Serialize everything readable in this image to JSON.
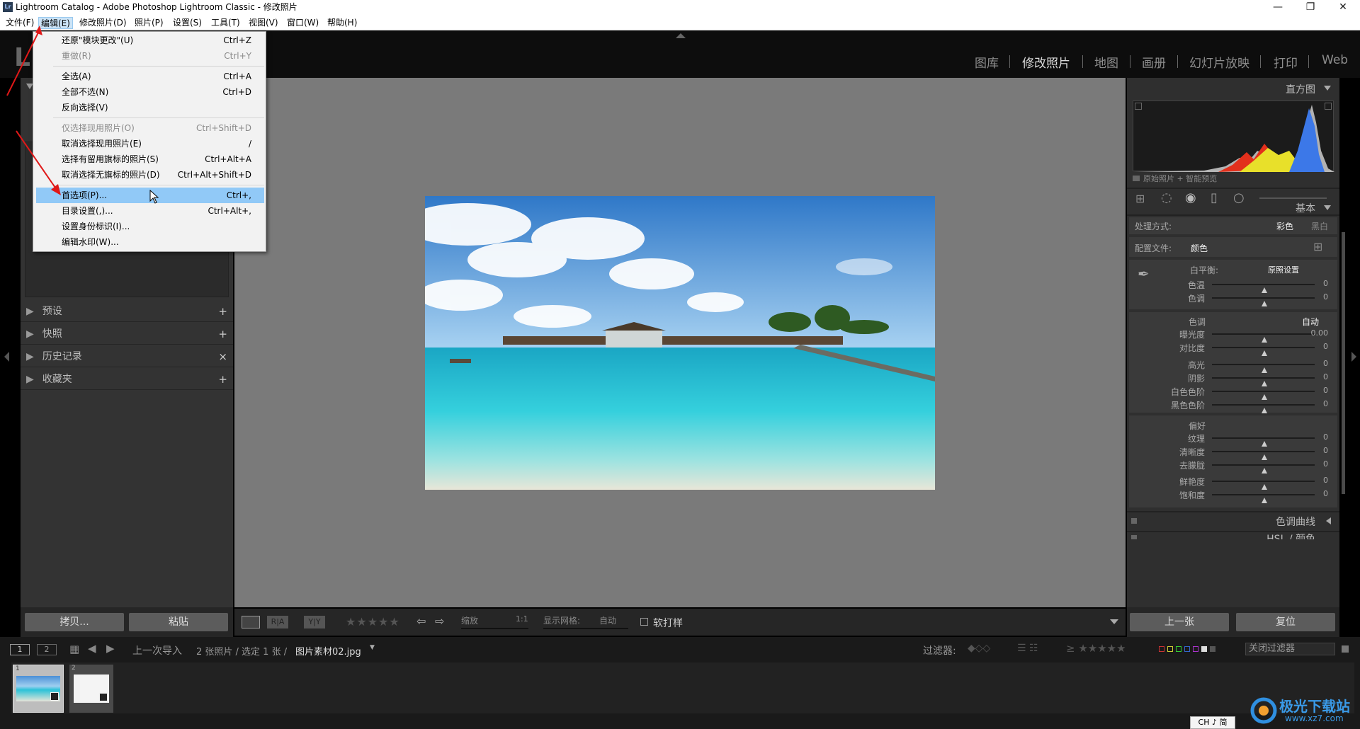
{
  "window": {
    "title": "Lightroom Catalog - Adobe Photoshop Lightroom Classic - 修改照片",
    "app_icon": "Lr",
    "minimize": "—",
    "maximize": "❐",
    "close": "✕"
  },
  "menubar": [
    "文件(F)",
    "编辑(E)",
    "修改照片(D)",
    "照片(P)",
    "设置(S)",
    "工具(T)",
    "视图(V)",
    "窗口(W)",
    "帮助(H)"
  ],
  "edit_menu": {
    "items": [
      {
        "label": "还原\"模块更改\"(U)",
        "shortcut": "Ctrl+Z"
      },
      {
        "label": "重做(R)",
        "shortcut": "Ctrl+Y"
      },
      {
        "label": "全选(A)",
        "shortcut": "Ctrl+A"
      },
      {
        "label": "全部不选(N)",
        "shortcut": "Ctrl+D"
      },
      {
        "label": "反向选择(V)",
        "shortcut": ""
      },
      {
        "label": "仅选择现用照片(O)",
        "shortcut": "Ctrl+Shift+D"
      },
      {
        "label": "取消选择现用照片(E)",
        "shortcut": "/"
      },
      {
        "label": "选择有留用旗标的照片(S)",
        "shortcut": "Ctrl+Alt+A"
      },
      {
        "label": "取消选择无旗标的照片(D)",
        "shortcut": "Ctrl+Alt+Shift+D"
      },
      {
        "label": "首选项(P)...",
        "shortcut": "Ctrl+,"
      },
      {
        "label": "目录设置(,)...",
        "shortcut": "Ctrl+Alt+,"
      },
      {
        "label": "设置身份标识(I)...",
        "shortcut": ""
      },
      {
        "label": "编辑水印(W)...",
        "shortcut": ""
      }
    ]
  },
  "modules": [
    "图库",
    "修改照片",
    "地图",
    "画册",
    "幻灯片放映",
    "打印",
    "Web"
  ],
  "left_panel": {
    "sections": [
      "预设",
      "快照",
      "历史记录",
      "收藏夹"
    ],
    "section_buttons": [
      "+",
      "+",
      "×",
      "+"
    ],
    "copy_btn": "拷贝...",
    "paste_btn": "粘贴"
  },
  "right_panel": {
    "histogram_title": "直方图",
    "preview_label": "原始照片 + 智能预览",
    "basic_title": "基本",
    "treatment_label": "处理方式:",
    "treatment_color": "彩色",
    "treatment_bw": "黑白",
    "profile_label": "配置文件:",
    "profile_value": "颜色",
    "wb_label": "白平衡:",
    "wb_value": "原照设置",
    "tone_label": "色调",
    "tone_auto": "自动",
    "presence_label": "偏好",
    "sliders": {
      "wb": [
        {
          "label": "色温",
          "value": "0"
        },
        {
          "label": "色调",
          "value": "0"
        }
      ],
      "tone1": [
        {
          "label": "曝光度",
          "value": "0.00"
        },
        {
          "label": "对比度",
          "value": "0"
        }
      ],
      "tone2": [
        {
          "label": "高光",
          "value": "0"
        },
        {
          "label": "阴影",
          "value": "0"
        },
        {
          "label": "白色色阶",
          "value": "0"
        },
        {
          "label": "黑色色阶",
          "value": "0"
        }
      ],
      "presence1": [
        {
          "label": "纹理",
          "value": "0"
        },
        {
          "label": "清晰度",
          "value": "0"
        },
        {
          "label": "去朦胧",
          "value": "0"
        }
      ],
      "presence2": [
        {
          "label": "鲜艳度",
          "value": "0"
        },
        {
          "label": "饱和度",
          "value": "0"
        }
      ]
    },
    "tone_curve_title": "色调曲线",
    "next_panel_title": "HSL / 颜色",
    "prev_btn": "上一张",
    "reset_btn": "复位"
  },
  "toolbar": {
    "zoom_label": "缩放",
    "zoom_value": "1:1",
    "grid_label": "显示网格:",
    "grid_value": "自动",
    "softproof_label": "软打样"
  },
  "filmstrip": {
    "page1": "1",
    "page2": "2",
    "source": "上一次导入",
    "count": "2 张照片 / 选定 1 张 /",
    "filename": "图片素材02.jpg",
    "filter_label": "过滤器:",
    "filter_off": "关闭过滤器",
    "thumb1_index": "1",
    "thumb2_index": "2"
  },
  "ime": "CH ♪ 简",
  "watermark": {
    "cn": "极光下载站",
    "url": "www.xz7.com"
  }
}
